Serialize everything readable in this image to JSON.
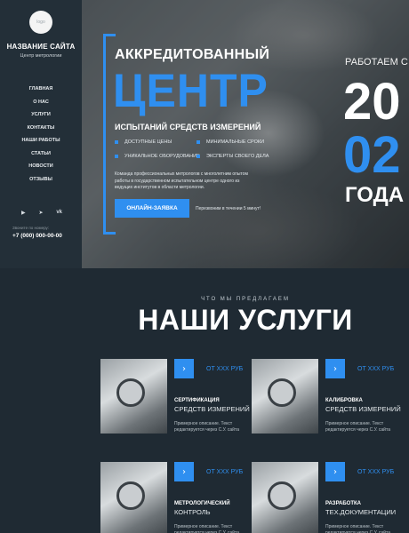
{
  "sidebar": {
    "logo_text": "logo",
    "site_name": "НАЗВАНИЕ САЙТА",
    "site_subtitle": "Центр метрологии",
    "menu": [
      "ГЛАВНАЯ",
      "О НАС",
      "УСЛУГИ",
      "КОНТАКТЫ",
      "НАШИ РАБОТЫ",
      "СТАТЬИ",
      "НОВОСТИ",
      "ОТЗЫВЫ"
    ],
    "socials": [
      "youtube-icon",
      "telegram-icon",
      "vk-icon"
    ],
    "phone_caption": "Звоните по номеру:",
    "phone": "+7 (000) 000-00-00"
  },
  "hero": {
    "title_line1": "АККРЕДИТОВАННЫЙ",
    "title_line2": "ЦЕНТР",
    "subtitle": "ИСПЫТАНИЙ СРЕДСТВ ИЗМЕРЕНИЙ",
    "features": [
      "ДОСТУПНЫЕ ЦЕНЫ",
      "МИНИМАЛЬНЫЕ СРОКИ",
      "УНИКАЛЬНОЕ ОБОРУДОВАНИЕ",
      "ЭКСПЕРТЫ СВОЕГО ДЕЛА"
    ],
    "description": "Команда профессиональных метрологов с многолетним опытом работы в государственном испытательном центре одного из ведущих институтов в области метрологии.",
    "cta_label": "ОНЛАЙН-ЗАЯВКА",
    "callback_text": "Перезвоним в течении 5 минут!",
    "works_since": "РАБОТАЕМ С",
    "year_part1": "20",
    "year_part2": "02",
    "years_word": "ГОДА",
    "accent_color": "#2f8ff0"
  },
  "services": {
    "caption": "ЧТО МЫ ПРЕДЛАГАЕМ",
    "title": "НАШИ УСЛУГИ",
    "items": [
      {
        "price": "ОТ ХХХ РУБ",
        "title1": "СЕРТИФИКАЦИЯ",
        "title2": "СРЕДСТВ ИЗМЕРЕНИЙ",
        "desc": "Примерное описание. Текст редактируется через С.У. сайта"
      },
      {
        "price": "ОТ ХХХ РУБ",
        "title1": "КАЛИБРОВКА",
        "title2": "СРЕДСТВ ИЗМЕРЕНИЙ",
        "desc": "Примерное описание. Текст редактируется через С.У. сайта"
      },
      {
        "price": "ОТ ХХХ РУБ",
        "title1": "МЕТРОЛОГИЧЕСКИЙ",
        "title2": "КОНТРОЛЬ",
        "desc": "Примерное описание. Текст редактируется через С.У. сайта"
      },
      {
        "price": "ОТ ХХХ РУБ",
        "title1": "РАЗРАБОТКА",
        "title2": "ТЕХ.ДОКУМЕНТАЦИИ",
        "desc": "Примерное описание. Текст редактируется через С.У. сайта"
      }
    ]
  }
}
